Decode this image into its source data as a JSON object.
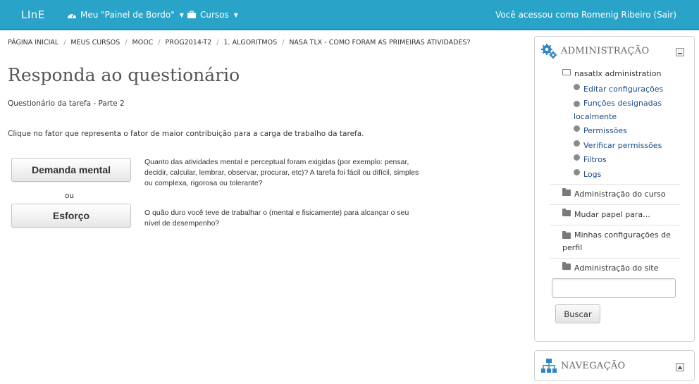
{
  "topbar": {
    "brand": "LInE",
    "nav": [
      {
        "label": "Meu \"Painel de Bordo\"",
        "icon": "dashboard-icon"
      },
      {
        "label": "Cursos",
        "icon": "briefcase-icon"
      }
    ],
    "login_text": "Você acessou como Romenig Ribeiro (",
    "logout_label": "Sair",
    "login_close": ")",
    "bg_color": "#29a3c7"
  },
  "breadcrumb": [
    "PÁGINA INICIAL",
    "MEUS CURSOS",
    "MOOC",
    "PROG2014-T2",
    "1. ALGORITMOS",
    "NASA TLX - COMO FORAM AS PRIMEIRAS ATIVIDADES?"
  ],
  "main": {
    "title": "Responda ao questionário",
    "subtitle": "Questionário da tarefa - Parte 2",
    "instruction": "Clique no fator que representa o fator de maior contribuição para a carga de trabalho da tarefa.",
    "choices": [
      {
        "label": "Demanda mental",
        "description": "Quanto das atividades mental e perceptual foram exigidas (por exemplo: pensar, decidir, calcular, lembrar, observar, procurar, etc)? A tarefa foi fácil ou difícil, simples ou complexa, rigorosa ou tolerante?"
      },
      {
        "label": "Esforço",
        "description": "O quão duro você teve de trabalhar o (mental e fisicamente) para alcançar o seu nível de desempenho?"
      }
    ],
    "separator": "ou"
  },
  "admin_block": {
    "title": "ADMINISTRAÇÃO",
    "icon": "gears-icon",
    "plugin_folder": "nasatlx administration",
    "plugin_items": [
      "Editar configurações",
      "Funções designadas localmente",
      "Permissões",
      "Verificar permissões",
      "Filtros",
      "Logs"
    ],
    "folders": [
      "Administração do curso",
      "Mudar papel para...",
      "Minhas configurações de perfil",
      "Administração do site"
    ],
    "search_placeholder": "",
    "search_button": "Buscar"
  },
  "nav_block": {
    "title": "NAVEGAÇÃO",
    "icon": "sitemap-icon"
  }
}
